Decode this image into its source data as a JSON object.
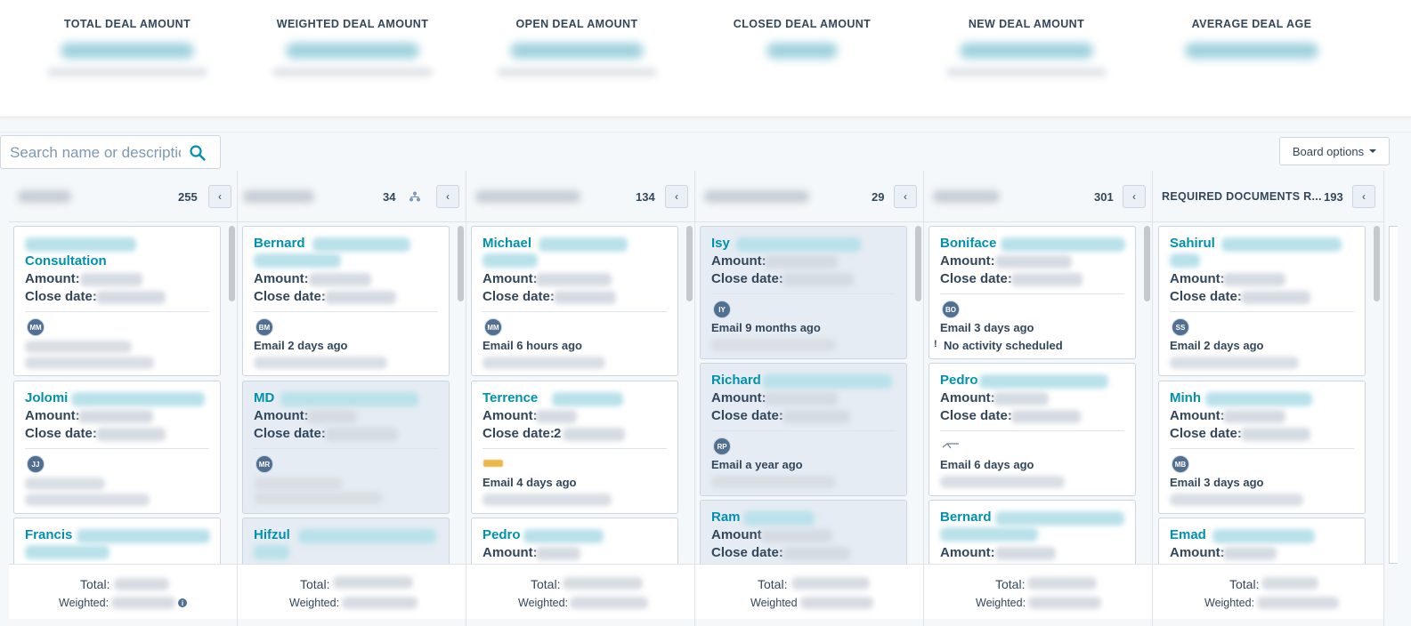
{
  "summary": {
    "metrics": [
      {
        "label": "TOTAL DEAL AMOUNT"
      },
      {
        "label": "WEIGHTED DEAL AMOUNT"
      },
      {
        "label": "OPEN DEAL AMOUNT"
      },
      {
        "label": "CLOSED DEAL AMOUNT"
      },
      {
        "label": "NEW DEAL AMOUNT"
      },
      {
        "label": "AVERAGE DEAL AGE"
      }
    ]
  },
  "toolbar": {
    "search_placeholder": "Search name or descriptio",
    "board_options_label": "Board options",
    "search_icon": "search-icon",
    "caret_icon": "chevron-down-icon"
  },
  "labels": {
    "amount": "Amount:",
    "amount_nocolon": "Amount",
    "close_date": "Close date:",
    "total": "Total:",
    "weighted": "Weighted:",
    "weighted_nocolon": "Weighted",
    "collapse_glyph": "‹"
  },
  "columns": [
    {
      "stage": "",
      "count": "255",
      "cards": [
        {
          "name": "",
          "name2": "Consultation",
          "avatar": "MM",
          "activity": ""
        },
        {
          "name": "Jolomi",
          "avatar": "JJ",
          "activity": ""
        },
        {
          "name": "Francis",
          "avatar": "",
          "activity": ""
        }
      ]
    },
    {
      "stage": "",
      "count": "34",
      "cards": [
        {
          "name": "Bernard",
          "avatar": "BM",
          "activity": "Email 2 days ago"
        },
        {
          "name": "MD",
          "avatar": "MR",
          "activity": ""
        },
        {
          "name": "Hifzul",
          "avatar": "",
          "activity": ""
        }
      ]
    },
    {
      "stage": "",
      "count": "134",
      "cards": [
        {
          "name": "Michael",
          "avatar": "MM",
          "activity": "Email 6 hours ago"
        },
        {
          "name": "Terrence",
          "avatar": "",
          "activity": "Email 4 days ago",
          "close_partial": "2"
        },
        {
          "name": "Pedro",
          "avatar": "",
          "activity": ""
        }
      ]
    },
    {
      "stage": "",
      "count": "29",
      "cards": [
        {
          "name": "Isy",
          "avatar": "IY",
          "activity": "Email 9 months ago"
        },
        {
          "name": "Richard",
          "avatar": "RP",
          "activity": "Email a year ago"
        },
        {
          "name": "Ram",
          "avatar": "",
          "activity": ""
        }
      ]
    },
    {
      "stage": "",
      "count": "301",
      "cards": [
        {
          "name": "Boniface",
          "avatar": "BO",
          "activity": "Email 3 days ago",
          "activity2": "No activity scheduled"
        },
        {
          "name": "Pedro",
          "avatar": "",
          "activity": "Email 6 days ago"
        },
        {
          "name": "Bernard",
          "avatar": "",
          "activity": ""
        }
      ]
    },
    {
      "stage": "REQUIRED DOCUMENTS R...",
      "count": "193",
      "cards": [
        {
          "name": "Sahirul",
          "avatar": "SS",
          "activity": "Email 2 days ago"
        },
        {
          "name": "Minh",
          "avatar": "MB",
          "activity": "Email 3 days ago"
        },
        {
          "name": "Emad",
          "avatar": "",
          "activity": ""
        }
      ]
    }
  ]
}
